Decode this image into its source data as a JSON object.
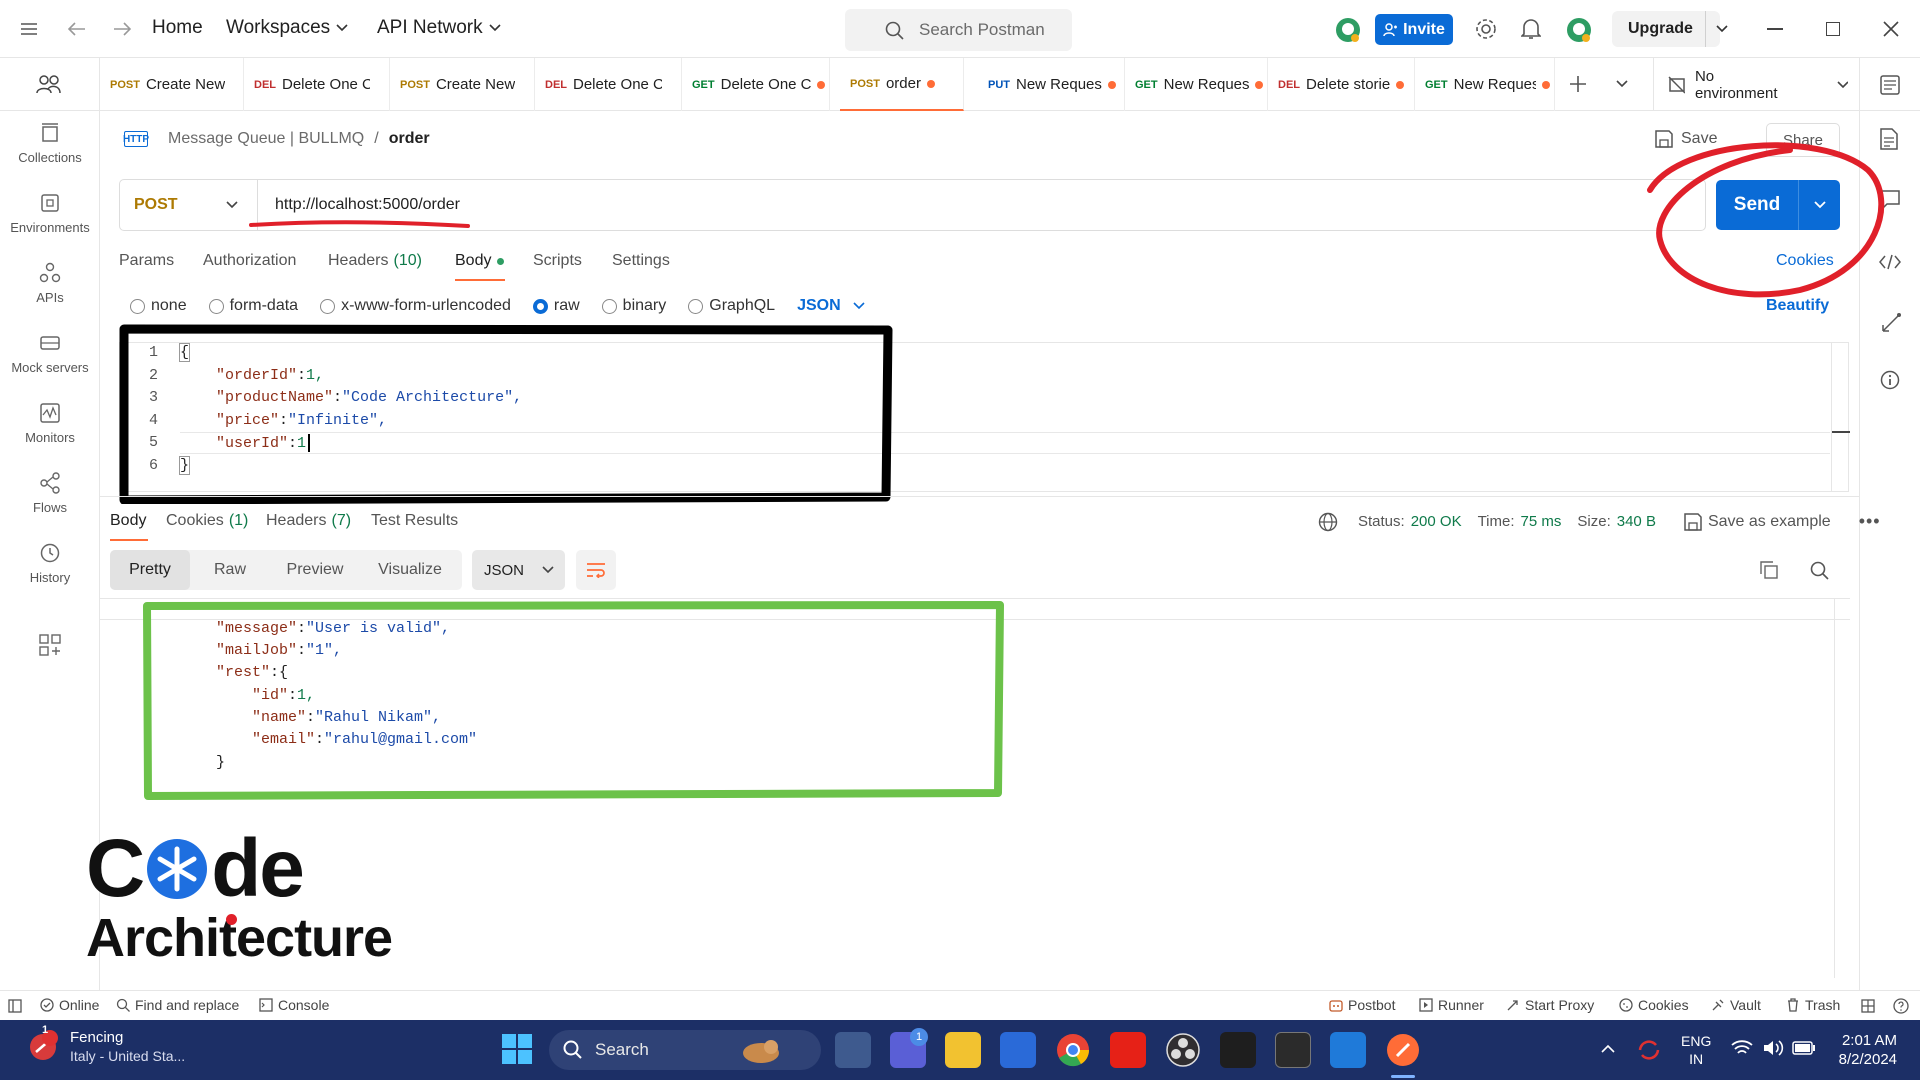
{
  "topbar": {
    "home": "Home",
    "workspaces": "Workspaces",
    "api_network": "API Network",
    "search_placeholder": "Search Postman",
    "invite": "Invite",
    "upgrade": "Upgrade"
  },
  "tabs": [
    {
      "method": "POST",
      "name": "Create New",
      "dot": false
    },
    {
      "method": "DEL",
      "name": "Delete One C",
      "dot": false
    },
    {
      "method": "POST",
      "name": "Create New",
      "dot": false
    },
    {
      "method": "DEL",
      "name": "Delete One C",
      "dot": false
    },
    {
      "method": "GET",
      "name": "Delete One C",
      "dot": true
    },
    {
      "method": "POST",
      "name": "order",
      "dot": true,
      "active": true
    },
    {
      "method": "PUT",
      "name": "New Reques",
      "dot": true
    },
    {
      "method": "GET",
      "name": "New Reques",
      "dot": true
    },
    {
      "method": "DEL",
      "name": "Delete storie",
      "dot": true
    },
    {
      "method": "GET",
      "name": "New Reques",
      "dot": true
    }
  ],
  "environment": "No environment",
  "sidebar": [
    {
      "label": "Collections",
      "icon": "collections-icon"
    },
    {
      "label": "Environments",
      "icon": "environments-icon"
    },
    {
      "label": "APIs",
      "icon": "apis-icon"
    },
    {
      "label": "Mock servers",
      "icon": "mock-servers-icon"
    },
    {
      "label": "Monitors",
      "icon": "monitors-icon"
    },
    {
      "label": "Flows",
      "icon": "flows-icon"
    },
    {
      "label": "History",
      "icon": "history-icon"
    }
  ],
  "breadcrumb": {
    "badge": "HTTP",
    "collection": "Message Queue | BULLMQ",
    "sep": "/",
    "current": "order"
  },
  "save": "Save",
  "share": "Share",
  "request": {
    "method": "POST",
    "url": "http://localhost:5000/order",
    "send": "Send"
  },
  "req_tabs": [
    "Params",
    "Authorization",
    "Headers",
    "(10)",
    "Body",
    "Scripts",
    "Settings"
  ],
  "cookies_link": "Cookies",
  "body_types": [
    "none",
    "form-data",
    "x-www-form-urlencoded",
    "raw",
    "binary",
    "GraphQL"
  ],
  "body_format": "JSON",
  "beautify": "Beautify",
  "request_body": {
    "line_numbers": [
      "1",
      "2",
      "3",
      "4",
      "5",
      "6"
    ],
    "open": "{",
    "close": "}",
    "k1": "\"orderId\"",
    "v1": "1,",
    "k2": "\"productName\"",
    "v2": "\"Code Architecture\",",
    "k3": "\"price\"",
    "v3": "\"Infinite\",",
    "k4": "\"userId\"",
    "v4": "1",
    "colon": ": "
  },
  "resp_tabs": {
    "body": "Body",
    "cookies": "Cookies",
    "cookies_count": "(1)",
    "headers": "Headers",
    "headers_count": "(7)",
    "tests": "Test Results"
  },
  "resp_meta": {
    "status_label": "Status:",
    "status": "200 OK",
    "time_label": "Time:",
    "time": "75 ms",
    "size_label": "Size:",
    "size": "340 B",
    "save_example": "Save as example"
  },
  "resp_view": {
    "pretty": "Pretty",
    "raw": "Raw",
    "preview": "Preview",
    "visualize": "Visualize",
    "format": "JSON"
  },
  "response_body": {
    "k1": "\"message\"",
    "v1": "\"User is valid\",",
    "k2": "\"mailJob\"",
    "v2": "\"1\",",
    "k3": "\"rest\"",
    "v3": "{",
    "k4": "\"id\"",
    "v4": "1,",
    "k5": "\"name\"",
    "v5": "\"Rahul Nikam\",",
    "k6": "\"email\"",
    "v6": "\"rahul@gmail.com\"",
    "inner_close": "}",
    "colon": ": "
  },
  "logo": {
    "line1_a": "C",
    "line1_b": "de",
    "line2": "Architecture"
  },
  "statusbar": {
    "online": "Online",
    "find": "Find and replace",
    "console": "Console",
    "postbot": "Postbot",
    "runner": "Runner",
    "proxy": "Start Proxy",
    "cookies": "Cookies",
    "vault": "Vault",
    "trash": "Trash"
  },
  "taskbar": {
    "weather_title": "Fencing",
    "weather_sub": "Italy - United Sta...",
    "badge": "1",
    "search": "Search",
    "lang1": "ENG",
    "lang2": "IN",
    "time": "2:01 AM",
    "date": "8/2/2024",
    "teams_badge": "1"
  },
  "colors": {
    "accent": "#0a6bd6",
    "orange": "#ff6c37",
    "annotation_red": "#e0202a",
    "annotation_green": "#6cc24a",
    "taskbar": "#1c2f66"
  }
}
